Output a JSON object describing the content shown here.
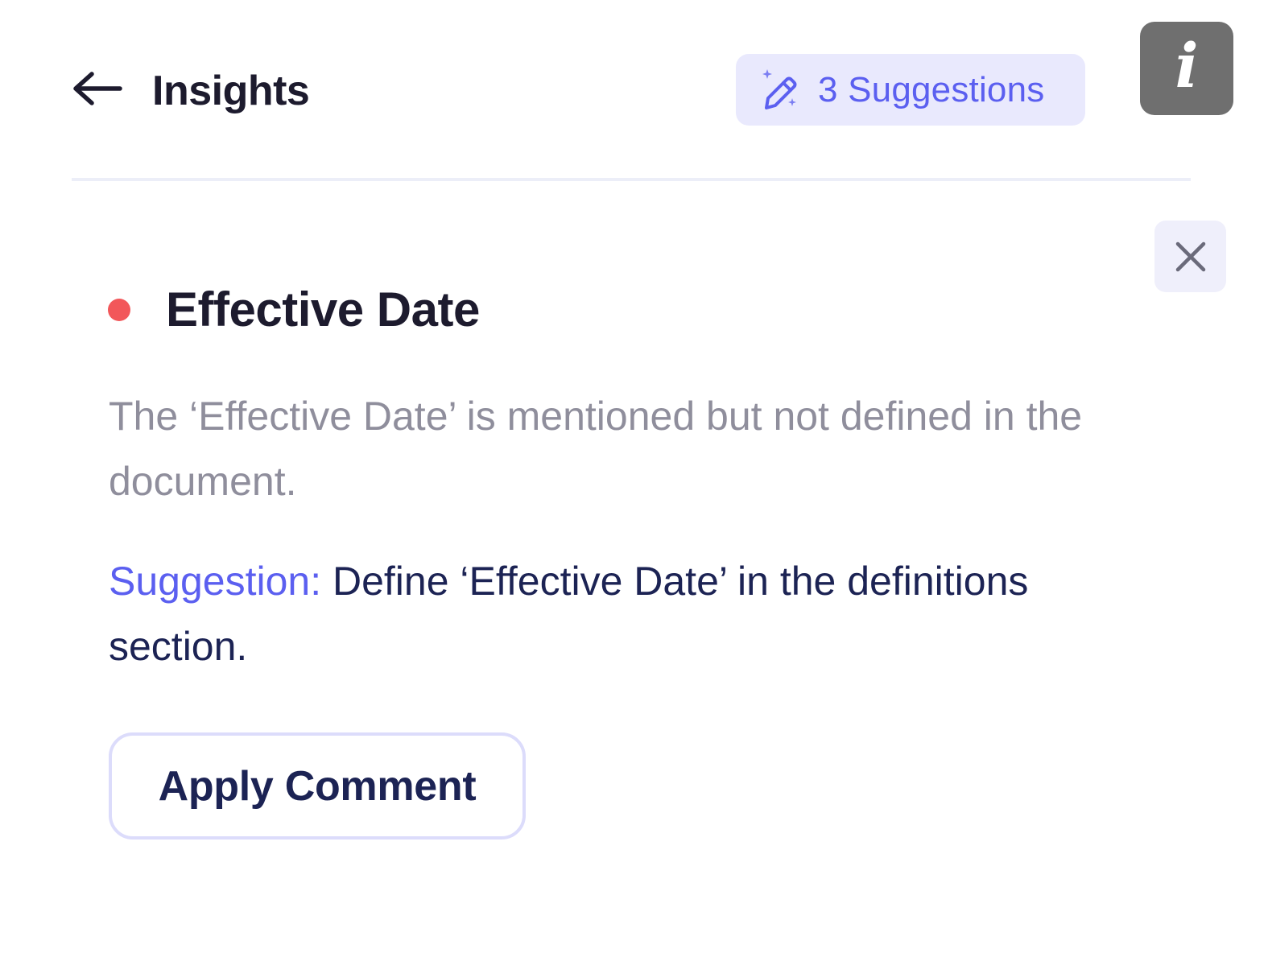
{
  "header": {
    "back_icon": "arrow-left-icon",
    "title": "Insights",
    "suggestions": {
      "icon": "magic-wand-pencil-icon",
      "label": "3 Suggestions"
    },
    "info": {
      "icon": "info-icon",
      "glyph": "i"
    }
  },
  "insight": {
    "close_icon": "close-icon",
    "status_color": "#f2575a",
    "title": "Effective Date",
    "description": "The ‘Effective Date’ is mentioned but not defined in the document.",
    "suggestion_prefix": "Suggestion:",
    "suggestion_text": "Define ‘Effective Date’ in the definitions section.",
    "apply_label": "Apply Comment"
  },
  "colors": {
    "accent": "#5b5ff0",
    "accent_bg": "#e9e9fd",
    "heading": "#1d1b2e",
    "muted_text": "#8f8e9c",
    "body_text": "#1c2354",
    "status_dot": "#f2575a"
  }
}
